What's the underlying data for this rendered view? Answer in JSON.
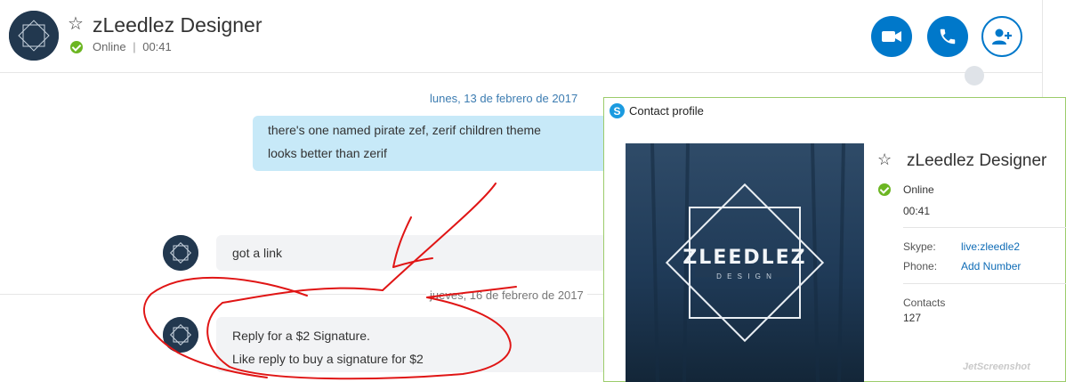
{
  "header": {
    "contact_name": "zLeedlez Designer",
    "status": "Online",
    "separator": "|",
    "call_time": "00:41",
    "icons": [
      "favorite-star-icon",
      "video-call-icon",
      "audio-call-icon",
      "add-people-icon",
      "globe-icon"
    ]
  },
  "conversation": {
    "date1": "lunes, 13 de febrero de 2017",
    "outgoing": {
      "line1": "there's one named pirate zef, zerif children theme",
      "line2": "looks better than zerif"
    },
    "incoming1": "got a link",
    "date2": "jueves, 16 de febrero de 2017",
    "incoming2": {
      "line1": "Reply for a $2 Signature.",
      "line2": "Like reply to buy a signature for $2"
    }
  },
  "profile": {
    "window_title": "Contact profile",
    "logo_text": "ZLEEDLEZ",
    "logo_subtext": "D E S I G N",
    "name": "zLeedlez Designer",
    "status": "Online",
    "call_time": "00:41",
    "skype_label": "Skype:",
    "skype_value": "live:zleedle2",
    "phone_label": "Phone:",
    "phone_value": "Add Number",
    "contacts_label": "Contacts",
    "contacts_value": "127"
  },
  "watermark": "JetScreenshot",
  "colors": {
    "accent": "#0078ca",
    "online": "#6cb622",
    "outgoing_bubble": "#c7e9f8",
    "incoming_bubble": "#f2f3f5",
    "date_text": "#3c7cb1",
    "annotation": "#e01515"
  }
}
